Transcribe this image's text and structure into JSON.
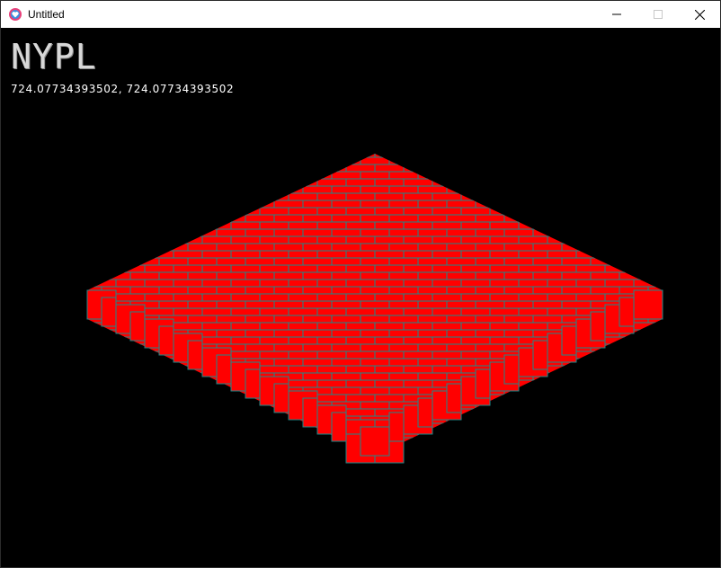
{
  "window": {
    "title": "Untitled",
    "controls": {
      "minimize": "minimize-icon",
      "maximize": "maximize-icon",
      "close": "close-icon"
    }
  },
  "hud": {
    "heading": "NYPL",
    "coords": "724.07734393502, 724.07734393502"
  },
  "board": {
    "brick_color": "#ff0000",
    "mortar_color": "#1b8a8a",
    "background": "#000000"
  }
}
